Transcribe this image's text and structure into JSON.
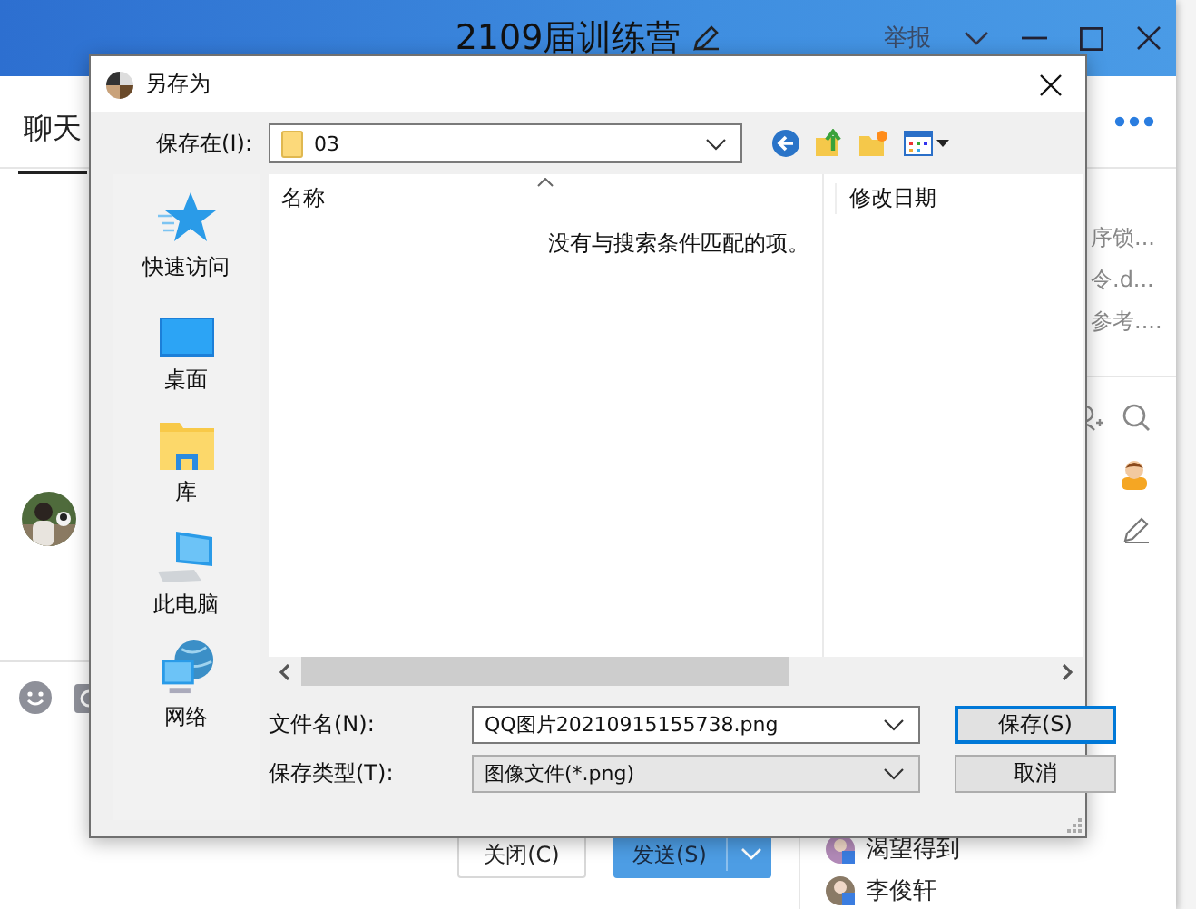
{
  "chat_window": {
    "title": "2109届训练营",
    "report": "举报",
    "tabs": [
      {
        "label": "聊天",
        "selected": true
      }
    ],
    "files": [
      "序锁...",
      "令.d...",
      "参考...."
    ],
    "members": [
      {
        "name": "渴望得到"
      },
      {
        "name": "李俊轩"
      }
    ],
    "close_button": "关闭(C)",
    "send_button": "发送(S)"
  },
  "dialog": {
    "title": "另存为",
    "save_in_label": "保存在(I):",
    "folder": "03",
    "places": [
      {
        "label": "快速访问",
        "kind": "star"
      },
      {
        "label": "桌面",
        "kind": "desktop"
      },
      {
        "label": "库",
        "kind": "library"
      },
      {
        "label": "此电脑",
        "kind": "computer"
      },
      {
        "label": "网络",
        "kind": "network"
      }
    ],
    "columns": [
      "名称",
      "修改日期"
    ],
    "empty_message": "没有与搜索条件匹配的项。",
    "file_name_label": "文件名(N):",
    "file_name": "QQ图片20210915155738.png",
    "file_type_label": "保存类型(T):",
    "file_type": "图像文件(*.png)",
    "buttons": [
      {
        "label": "保存(S)",
        "default": true
      },
      {
        "label": "取消",
        "default": false
      }
    ]
  }
}
